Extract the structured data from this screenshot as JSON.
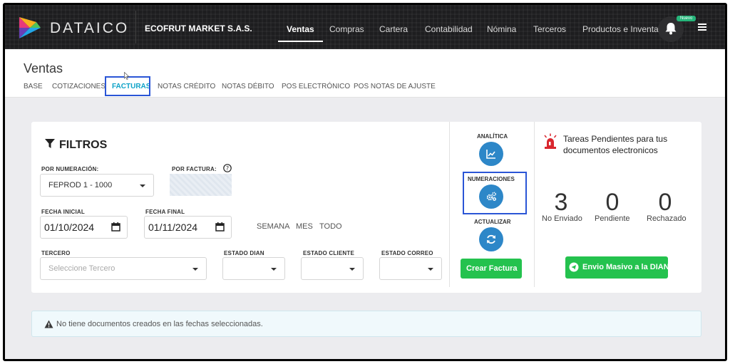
{
  "nav": {
    "brand": "DATAICO",
    "company": "ECOFRUT MARKET S.A.S.",
    "items": [
      "Ventas",
      "Compras",
      "Cartera",
      "Contabilidad",
      "Nómina",
      "Terceros",
      "Productos e Inventario"
    ],
    "active": "Ventas",
    "notification_badge": "Nuevo"
  },
  "page": {
    "title": "Ventas",
    "subtabs": [
      "BASE",
      "COTIZACIONES",
      "FACTURAS",
      "NOTAS CRÉDITO",
      "NOTAS DÉBITO",
      "POS ELECTRÓNICO",
      "POS NOTAS DE AJUSTE"
    ],
    "active_subtab": "FACTURAS"
  },
  "filters": {
    "title": "FILTROS",
    "numeracion_label": "POR NUMERACIÓN:",
    "numeracion_value": "FEPROD 1 - 1000",
    "factura_label": "POR FACTURA:",
    "fecha_inicial_label": "FECHA INICIAL",
    "fecha_inicial_value": "01/10/2024",
    "fecha_final_label": "FECHA FINAL",
    "fecha_final_value": "01/11/2024",
    "range_semana": "SEMANA",
    "range_mes": "MES",
    "range_todo": "TODO",
    "tercero_label": "TERCERO",
    "tercero_placeholder": "Seleccione Tercero",
    "estado_dian_label": "ESTADO DIAN",
    "estado_cliente_label": "ESTADO CLIENTE",
    "estado_correo_label": "ESTADO CORREO"
  },
  "actions": {
    "analitica": "ANALÍTICA",
    "numeraciones": "NUMERACIONES",
    "actualizar": "ACTUALIZAR",
    "crear_factura": "Crear Factura"
  },
  "tasks": {
    "title": "Tareas Pendientes para tus documentos electronicos",
    "stats": [
      {
        "value": "3",
        "label": "No Enviado"
      },
      {
        "value": "0",
        "label": "Pendiente"
      },
      {
        "value": "0",
        "label": "Rechazado"
      }
    ],
    "envio_masivo": "Envio Masivo a la DIAN"
  },
  "alert": {
    "text": "No tiene documentos creados en las fechas seleccionadas."
  },
  "colors": {
    "accent_blue": "#2d87c8",
    "active_tab": "#0fa3c8",
    "green": "#24c24e",
    "highlight_box": "#2a55d6"
  }
}
